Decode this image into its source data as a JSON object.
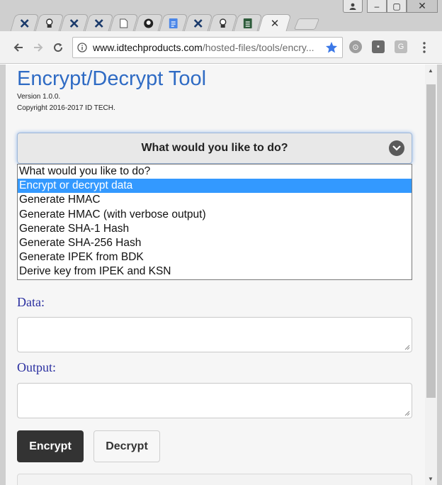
{
  "browser": {
    "tabs": [
      {
        "icon": "idtech-x-icon"
      },
      {
        "icon": "jenkins-icon"
      },
      {
        "icon": "idtech-x-icon"
      },
      {
        "icon": "idtech-x-icon"
      },
      {
        "icon": "document-icon"
      },
      {
        "icon": "github-icon"
      },
      {
        "icon": "google-docs-icon"
      },
      {
        "icon": "idtech-x-icon"
      },
      {
        "icon": "jenkins-icon"
      },
      {
        "icon": "sheet-icon"
      },
      {
        "icon": "idtech-x-icon",
        "active": true
      }
    ],
    "url_host": "www.idtechproducts.com",
    "url_path": "/hosted-files/tools/encry..."
  },
  "page": {
    "title": "Encrypt/Decrypt Tool",
    "version": "Version 1.0.0.",
    "copyright": "Copyright 2016-2017 ID TECH."
  },
  "operation_select": {
    "selected_label": "What would you like to do?",
    "options": [
      "What would you like to do?",
      "Encrypt or decrypt data",
      "Generate HMAC",
      "Generate HMAC (with verbose output)",
      "Generate SHA-1 Hash",
      "Generate SHA-256 Hash",
      "Generate IPEK from BDK",
      "Derive key from IPEK and KSN"
    ],
    "highlighted_index": 1
  },
  "form": {
    "data_label": "Data:",
    "data_value": "",
    "output_label": "Output:",
    "output_value": "",
    "encrypt_label": "Encrypt",
    "decrypt_label": "Decrypt"
  },
  "colors": {
    "title": "#2f6bc4",
    "label": "#2a2fa0",
    "highlight": "#3399ff",
    "primary_button": "#333333"
  }
}
